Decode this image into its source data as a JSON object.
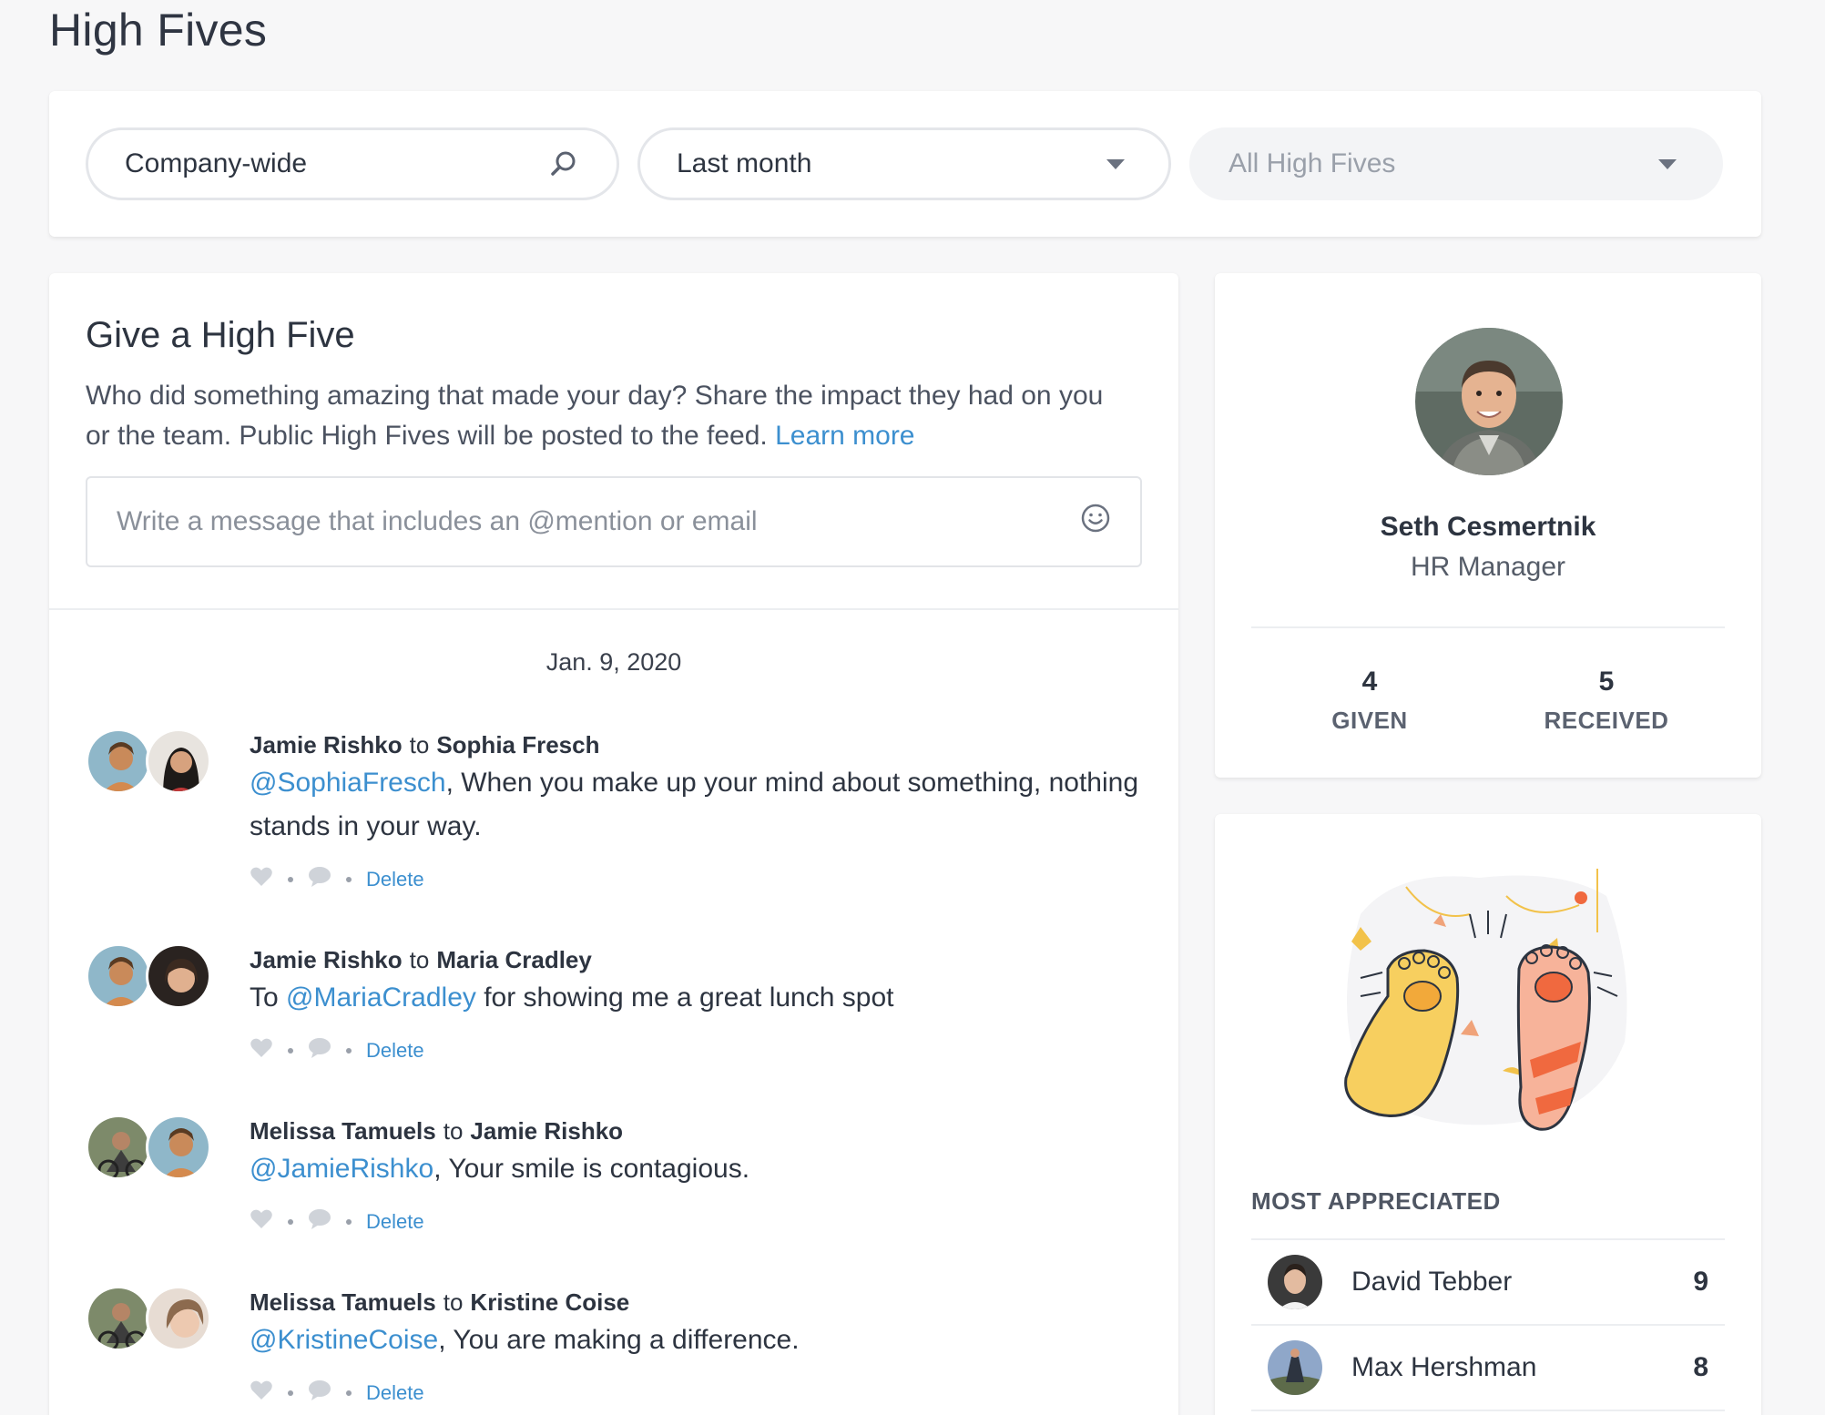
{
  "page": {
    "title": "High Fives"
  },
  "filters": {
    "scope": "Company-wide",
    "period": "Last month",
    "type": "All High Fives"
  },
  "compose": {
    "heading": "Give a High Five",
    "description": "Who did something amazing that made your day? Share the impact they had on you or the team. Public High Fives will be posted to the feed.",
    "learn_more": "Learn more",
    "placeholder": "Write a message that includes an @mention or email"
  },
  "feed": {
    "date": "Jan. 9, 2020",
    "posts": [
      {
        "from": "Jamie Rishko",
        "to_word": "to",
        "to": "Sophia Fresch",
        "mention": "@SophiaFresch",
        "text": ", When you make up your mind about something, nothing stands in your way.",
        "prefix": "",
        "delete": "Delete"
      },
      {
        "from": "Jamie Rishko",
        "to_word": "to",
        "to": "Maria Cradley",
        "prefix": "To ",
        "mention": "@MariaCradley",
        "text": " for showing me a great lunch spot",
        "delete": "Delete"
      },
      {
        "from": "Melissa Tamuels",
        "to_word": "to",
        "to": "Jamie Rishko",
        "prefix": "",
        "mention": "@JamieRishko",
        "text": ", Your smile is contagious.",
        "delete": "Delete"
      },
      {
        "from": "Melissa Tamuels",
        "to_word": "to",
        "to": "Kristine Coise",
        "prefix": "",
        "mention": "@KristineCoise",
        "text": ", You are making a difference.",
        "delete": "Delete"
      }
    ]
  },
  "profile": {
    "name": "Seth Cesmertnik",
    "role": "HR Manager",
    "given": "4",
    "given_label": "GIVEN",
    "received": "5",
    "received_label": "RECEIVED"
  },
  "most_appreciated": {
    "title": "MOST APPRECIATED",
    "people": [
      {
        "name": "David Tebber",
        "count": "9"
      },
      {
        "name": "Max Hershman",
        "count": "8"
      }
    ]
  },
  "colors": {
    "accent": "#3c8fcf",
    "text": "#2d3440",
    "background": "#f7f7f8"
  }
}
